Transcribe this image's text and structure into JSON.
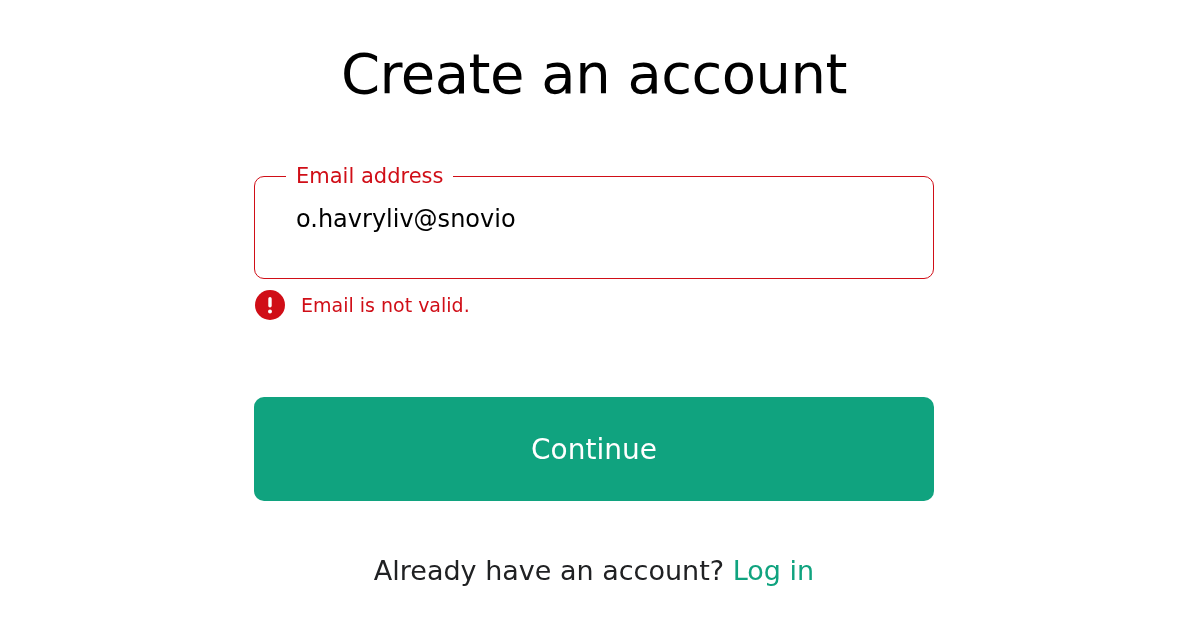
{
  "title": "Create an account",
  "email_field": {
    "label": "Email address",
    "value": "o.havryliv@snovio",
    "invalid": true,
    "error": "Email is not valid."
  },
  "continue_button": {
    "label": "Continue"
  },
  "footer": {
    "text": "Already have an account?",
    "link": "Log in"
  }
}
